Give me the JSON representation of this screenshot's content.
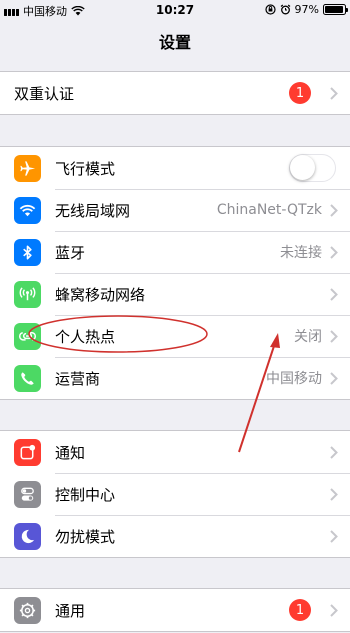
{
  "status_bar": {
    "carrier": "中国移动",
    "time": "10:27",
    "battery": "97%"
  },
  "nav": {
    "title": "设置"
  },
  "group_account": [
    {
      "label": "双重认证",
      "badge": "1"
    }
  ],
  "group_network": [
    {
      "label": "飞行模式",
      "icon": "airplane-icon",
      "color": "#ff9500",
      "toggle": "off"
    },
    {
      "label": "无线局域网",
      "icon": "wifi-icon",
      "color": "#007aff",
      "value": "ChinaNet-QTzk"
    },
    {
      "label": "蓝牙",
      "icon": "bluetooth-icon",
      "color": "#007aff",
      "value": "未连接"
    },
    {
      "label": "蜂窝移动网络",
      "icon": "cellular-icon",
      "color": "#4cd964"
    },
    {
      "label": "个人热点",
      "icon": "hotspot-icon",
      "color": "#4cd964",
      "value": "关闭"
    },
    {
      "label": "运营商",
      "icon": "phone-icon",
      "color": "#4cd964",
      "value": "中国移动"
    }
  ],
  "group_notifications": [
    {
      "label": "通知",
      "icon": "notification-icon",
      "color": "#ff3b30"
    },
    {
      "label": "控制中心",
      "icon": "control-center-icon",
      "color": "#8e8e93"
    },
    {
      "label": "勿扰模式",
      "icon": "moon-icon",
      "color": "#5856d6"
    }
  ],
  "group_general": [
    {
      "label": "通用",
      "icon": "gear-icon",
      "color": "#8e8e93",
      "badge": "1"
    }
  ],
  "annotation_color": "#d0312d"
}
